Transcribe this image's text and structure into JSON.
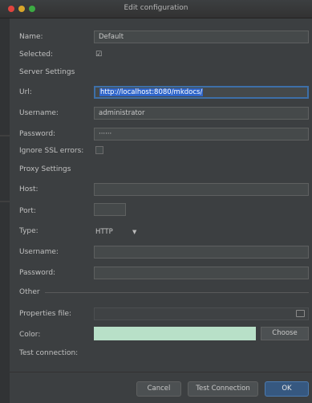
{
  "window": {
    "title": "Edit configuration"
  },
  "form": {
    "name_label": "Name:",
    "name_value": "Default",
    "selected_label": "Selected:",
    "selected_value": "☑",
    "server_settings_header": "Server Settings",
    "url_label": "Url:",
    "url_value": "http://localhost:8080/mkdocs/",
    "username_label": "Username:",
    "username_value": "administrator",
    "password_label": "Password:",
    "password_value": "······",
    "ignore_ssl_label": "Ignore SSL errors:",
    "proxy_settings_header": "Proxy Settings",
    "host_label": "Host:",
    "host_value": "",
    "port_label": "Port:",
    "type_label": "Type:",
    "type_value": "HTTP",
    "proxy_username_label": "Username:",
    "proxy_username_value": "",
    "proxy_password_label": "Password:",
    "proxy_password_value": "",
    "other_header": "Other",
    "properties_file_label": "Properties file:",
    "color_label": "Color:",
    "choose_label": "Choose",
    "test_connection_text_label": "Test connection:"
  },
  "footer": {
    "cancel_label": "Cancel",
    "test_connection_label": "Test Connection",
    "ok_label": "OK"
  },
  "colors": {
    "accent_selection": "#2f65ca",
    "primary_button": "#365880",
    "color_swatch": "#b8e0c8",
    "dialog_bg": "#3c3f41"
  },
  "icons": {
    "folder": "folder-icon",
    "dropdown_arrow": "chevron-down-icon"
  }
}
